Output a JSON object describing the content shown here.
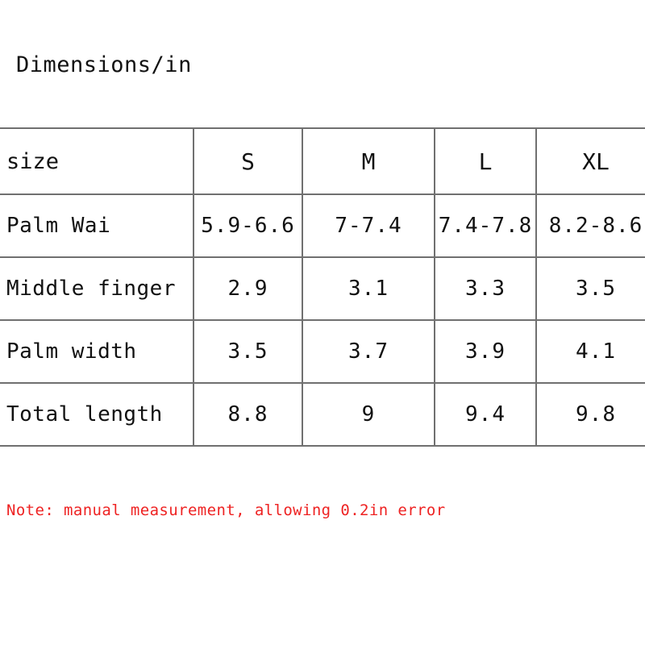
{
  "document": {
    "title": "Dimensions/in",
    "note": "Note: manual measurement, allowing 0.2in error",
    "note_color": "#ee2222",
    "border_color": "#707070",
    "text_color": "#111111",
    "background_color": "#ffffff"
  },
  "table": {
    "columns": [
      {
        "key": "label",
        "label": "size"
      },
      {
        "key": "s",
        "label": "S"
      },
      {
        "key": "m",
        "label": "M"
      },
      {
        "key": "l",
        "label": "L"
      },
      {
        "key": "xl",
        "label": "XL"
      }
    ],
    "rows": [
      {
        "label": "Palm Wai",
        "s": "5.9-6.6",
        "m": "7-7.4",
        "l": "7.4-7.8",
        "xl": "8.2-8.6"
      },
      {
        "label": "Middle finger",
        "s": "2.9",
        "m": "3.1",
        "l": "3.3",
        "xl": "3.5"
      },
      {
        "label": "Palm width",
        "s": "3.5",
        "m": "3.7",
        "l": "3.9",
        "xl": "4.1"
      },
      {
        "label": "Total length",
        "s": "8.8",
        "m": "9",
        "l": "9.4",
        "xl": "9.8"
      }
    ]
  }
}
